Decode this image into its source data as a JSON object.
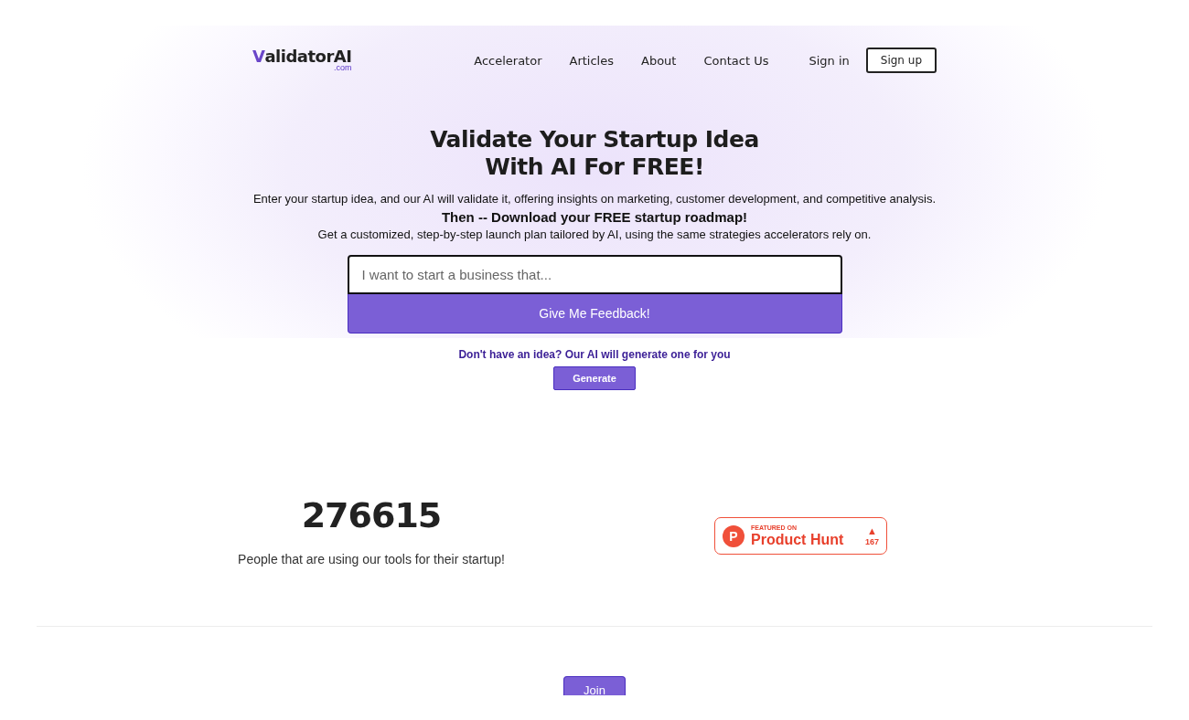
{
  "logo": {
    "name": "ValidatorAI",
    "suffix": ".com"
  },
  "nav": {
    "links": [
      "Accelerator",
      "Articles",
      "About",
      "Contact Us"
    ],
    "sign_in": "Sign in",
    "sign_up": "Sign up"
  },
  "hero": {
    "title_lines": [
      "Validate Your Startup Idea",
      "With AI For FREE!"
    ],
    "intro": "Enter your startup idea, and our AI will validate it, offering insights on marketing, customer development, and competitive analysis.",
    "callout": "Then -- Download your FREE startup roadmap!",
    "detail": "Get a customized, step-by-step launch plan tailored by AI, using the same strategies accelerators rely on.",
    "input": {
      "placeholder": "I want to start a business that..."
    },
    "submit": "Give Me Feedback!",
    "idea_prompt": "Don't have an idea? Our AI will generate one for you",
    "generate": "Generate"
  },
  "stats": {
    "count": "276615",
    "caption": "People that are using our tools for their startup!"
  },
  "product_hunt": {
    "logo_letter": "P",
    "featured": "FEATURED ON",
    "name": "Product Hunt",
    "arrow": "▲",
    "votes": "167"
  },
  "join": "Join"
}
